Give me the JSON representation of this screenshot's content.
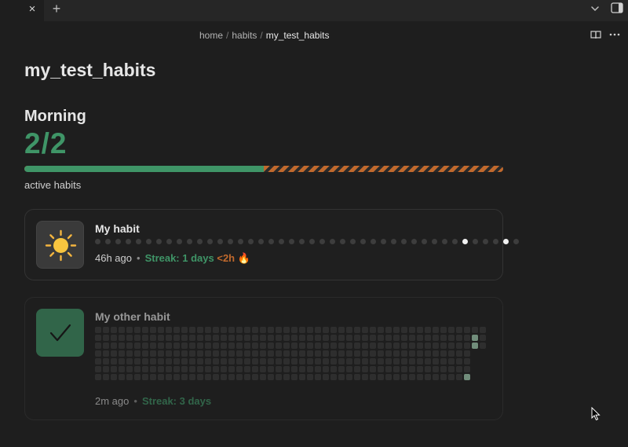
{
  "tabs": {
    "close_glyph": "×",
    "new_glyph": "+"
  },
  "breadcrumb": {
    "items": [
      "home",
      "habits",
      "my_test_habits"
    ],
    "separator": "/"
  },
  "page": {
    "title": "my_test_habits"
  },
  "group": {
    "title": "Morning",
    "counter": "2/2",
    "progress_fraction": 0.5,
    "label": "active habits"
  },
  "habits": [
    {
      "name": "My habit",
      "icon": "sun-icon",
      "last": "46h ago",
      "bullet": "•",
      "streak": "Streak: 1 days",
      "since": "<2h",
      "flame": "🔥",
      "dots_total": 42,
      "dots_on": [
        36,
        40
      ]
    },
    {
      "name": "My other habit",
      "icon": "check-icon",
      "last": "2m ago",
      "bullet": "•",
      "streak": "Streak: 3 days"
    }
  ],
  "colors": {
    "accent_green": "#3f9567",
    "accent_orange": "#c0692d",
    "background": "#1e1e1e"
  }
}
